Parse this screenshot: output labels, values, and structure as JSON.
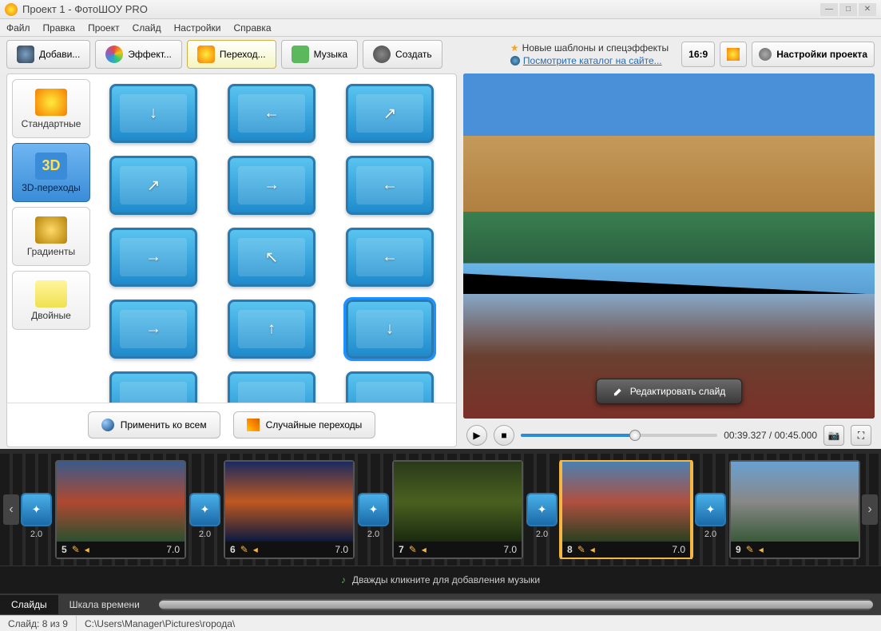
{
  "window": {
    "title": "Проект 1 - ФотоШОУ PRO"
  },
  "menu": [
    "Файл",
    "Правка",
    "Проект",
    "Слайд",
    "Настройки",
    "Справка"
  ],
  "tabs": {
    "add": "Добави...",
    "effects": "Эффект...",
    "transitions": "Переход...",
    "music": "Музыка",
    "create": "Создать"
  },
  "promo": {
    "templates": "Новые шаблоны и спецэффекты",
    "catalog": "Посмотрите каталог на сайте..."
  },
  "toolbar_right": {
    "aspect": "16:9",
    "settings": "Настройки проекта"
  },
  "categories": {
    "standard": "Стандартные",
    "threed": "3D-переходы",
    "threed_icon": "3D",
    "gradients": "Градиенты",
    "double": "Двойные"
  },
  "transitions_grid": [
    {
      "arrow": "↓"
    },
    {
      "arrow": "←"
    },
    {
      "arrow": "↗"
    },
    {
      "arrow": "↗"
    },
    {
      "arrow": "→"
    },
    {
      "arrow": "←"
    },
    {
      "arrow": "→"
    },
    {
      "arrow": "↖"
    },
    {
      "arrow": "←"
    },
    {
      "arrow": "→"
    },
    {
      "arrow": "↑"
    },
    {
      "arrow": "↓",
      "selected": true
    },
    {
      "arrow": ""
    },
    {
      "arrow": ""
    },
    {
      "arrow": ""
    }
  ],
  "left_actions": {
    "apply_all": "Применить ко всем",
    "random": "Случайные переходы"
  },
  "preview": {
    "edit": "Редактировать слайд"
  },
  "playback": {
    "current": "00:39.327",
    "total": "00:45.000",
    "separator": " / "
  },
  "timeline": {
    "slides": [
      {
        "num": "5",
        "dur": "7.0",
        "trans": "2.0",
        "imgClass": "si1"
      },
      {
        "num": "6",
        "dur": "7.0",
        "trans": "2.0",
        "imgClass": "si2"
      },
      {
        "num": "7",
        "dur": "7.0",
        "trans": "2.0",
        "imgClass": "si3"
      },
      {
        "num": "8",
        "dur": "7.0",
        "trans": "2.0",
        "imgClass": "si4",
        "selected": true
      },
      {
        "num": "9",
        "dur": "",
        "trans": "2.0",
        "imgClass": "si5"
      }
    ],
    "music_hint": "Дважды кликните для добавления музыки"
  },
  "bottom_tabs": {
    "slides": "Слайды",
    "timeline": "Шкала времени"
  },
  "status": {
    "slide": "Слайд: 8 из 9",
    "path": "C:\\Users\\Manager\\Pictures\\города\\"
  }
}
